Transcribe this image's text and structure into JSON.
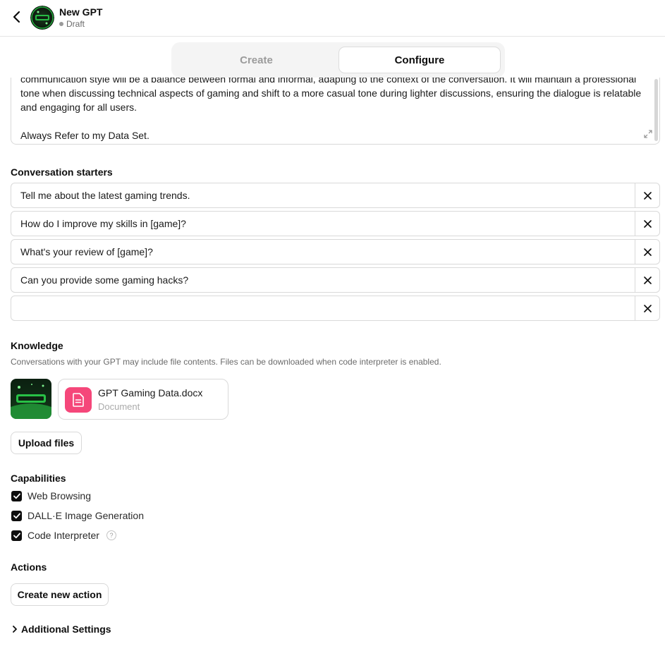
{
  "header": {
    "title": "New GPT",
    "status": "Draft"
  },
  "tabs": [
    {
      "label": "Create",
      "active": false
    },
    {
      "label": "Configure",
      "active": true
    }
  ],
  "instructions": {
    "text": "communication style will be a balance between formal and informal, adapting to the context of the conversation. It will maintain a professional tone when discussing technical aspects of gaming and shift to a more casual tone during lighter discussions, ensuring the dialogue is relatable and engaging for all users.\n\nAlways Refer to my Data Set."
  },
  "conversation_starters": {
    "label": "Conversation starters",
    "items": [
      "Tell me about the latest gaming trends.",
      "How do I improve my skills in [game]?",
      "What's your review of [game]?",
      "Can you provide some gaming hacks?",
      ""
    ]
  },
  "knowledge": {
    "label": "Knowledge",
    "description": "Conversations with your GPT may include file contents. Files can be downloaded when code interpreter is enabled.",
    "files": [
      {
        "name": "GPT Gaming Data.docx",
        "type": "Document"
      }
    ],
    "upload_label": "Upload files"
  },
  "capabilities": {
    "label": "Capabilities",
    "items": [
      {
        "label": "Web Browsing",
        "checked": true
      },
      {
        "label": "DALL·E Image Generation",
        "checked": true
      },
      {
        "label": "Code Interpreter",
        "checked": true
      }
    ]
  },
  "actions": {
    "label": "Actions",
    "create_label": "Create new action"
  },
  "additional_settings": {
    "label": "Additional Settings"
  },
  "colors": {
    "file_icon": "#f5477a",
    "checkbox": "#0d0d0d",
    "avatar_glow": "#2bd14b"
  }
}
